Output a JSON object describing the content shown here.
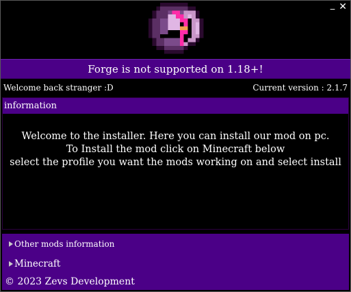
{
  "window": {
    "minimize_label": "_",
    "close_label": "✕"
  },
  "logo": {
    "icon": "enchanted-book-icon",
    "colors": {
      "outline": "#2a0a2e",
      "cover_dark": "#5b2f64",
      "cover_mid": "#7b4b8a",
      "pages_light": "#c896c8",
      "pages_lighter": "#e0b6e4",
      "accent_pink": "#ff2ca8",
      "accent_gold": "#f0a050"
    }
  },
  "warning": {
    "text": "Forge is not supported on 1.18+!"
  },
  "status": {
    "welcome": "Welcome back stranger :D",
    "version": "Current version : 2.1.7"
  },
  "info_panel": {
    "header": "information",
    "lines": [
      "Welcome to the installer. Here you can install our mod on pc.",
      "To Install the mod click on Minecraft below",
      "select the profile you want the mods working on and select install"
    ]
  },
  "bottom": {
    "other_mods": "Other mods information",
    "minecraft": "Minecraft",
    "copyright": "© 2023 Zevs Development"
  },
  "theme": {
    "accent": "#4b0087",
    "background": "#000000",
    "text": "#ffffff"
  }
}
